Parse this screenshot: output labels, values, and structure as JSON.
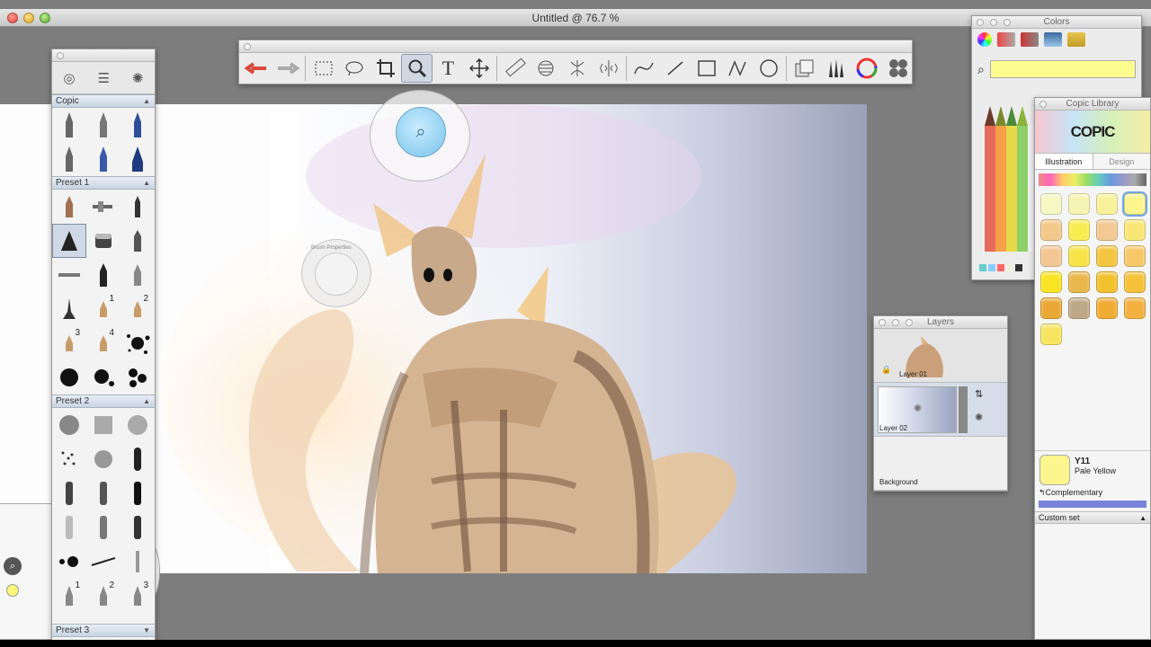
{
  "window": {
    "title": "Untitled @ 76.7 %"
  },
  "toolbar": {
    "tools": [
      "undo-icon",
      "redo-icon",
      "rect-select-icon",
      "lasso-icon",
      "crop-icon",
      "zoom-icon",
      "text-icon",
      "move-icon",
      "ruler-icon",
      "ellipse-ruler-icon",
      "symmetry-icon",
      "mirror-icon",
      "curve-icon",
      "line-icon",
      "rectangle-icon",
      "polyline-icon",
      "circle-icon",
      "copy-paste-icon",
      "brush-library-icon",
      "color-wheel-icon",
      "palette-icon"
    ]
  },
  "brushes": {
    "copic_label": "Copic",
    "preset1_label": "Preset 1",
    "preset2_label": "Preset 2",
    "preset3_label": "Preset 3",
    "preset1_numbers": [
      "1",
      "2",
      "3",
      "4"
    ],
    "preset2_numbers": [
      "1",
      "2",
      "3"
    ]
  },
  "colors": {
    "title": "Colors",
    "search_value": ""
  },
  "copic_library": {
    "title": "Copic Library",
    "logo": "COPIC",
    "tab_illustration": "Illustration",
    "tab_design": "Design",
    "selected_code": "Y11",
    "selected_name": "Pale Yellow",
    "complementary_label": "Complementary",
    "custom_set_label": "Custom set",
    "swatches": [
      "#f7f7c4",
      "#f6f4b2",
      "#f8f19a",
      "#fdf58e",
      "#f3c98b",
      "#f8ec53",
      "#f2c893",
      "#f8e776",
      "#f3c794",
      "#f7e44b",
      "#f4c542",
      "#f7c86a",
      "#f8e422",
      "#e9b74c",
      "#f2c12e",
      "#f5c13a",
      "#e9a835",
      "#bda888",
      "#f0ac34",
      "#f3b03f",
      "#f7e561"
    ],
    "accent_color": "#7a83d9"
  },
  "layers": {
    "title": "Layers",
    "items": [
      "Layer 01",
      "Layer 02",
      "Background"
    ]
  },
  "widgets": {
    "brush_properties_label": "Brush Properties"
  }
}
